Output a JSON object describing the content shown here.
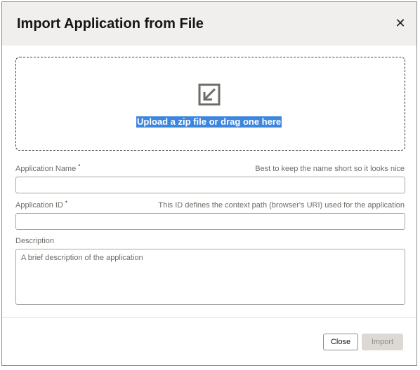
{
  "dialog": {
    "title": "Import Application from File",
    "close_icon": "close-icon"
  },
  "dropzone": {
    "icon": "import-arrow-icon",
    "label": "Upload a zip file or drag one here"
  },
  "fields": {
    "app_name": {
      "label": "Application Name",
      "required_marker": "•",
      "hint": "Best to keep the name short so it looks nice",
      "value": ""
    },
    "app_id": {
      "label": "Application ID",
      "required_marker": "•",
      "hint": "This ID defines the context path (browser's URI) used for the application",
      "value": ""
    },
    "description": {
      "label": "Description",
      "placeholder": "A brief description of the application",
      "value": ""
    }
  },
  "footer": {
    "close_label": "Close",
    "import_label": "Import"
  },
  "colors": {
    "header_bg": "#f1efed",
    "selection_highlight": "#3d86de",
    "disabled_button_bg": "#dcd9d5"
  }
}
